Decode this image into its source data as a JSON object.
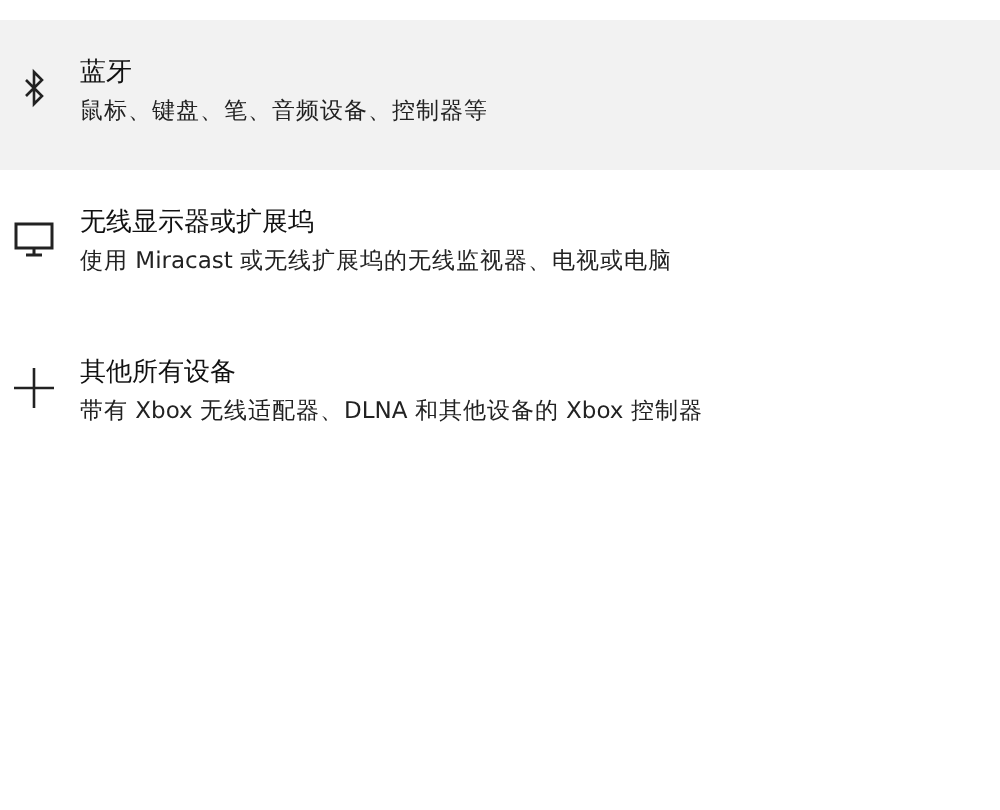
{
  "options": [
    {
      "kind": "bluetooth",
      "title": "蓝牙",
      "subtitle": "鼠标、键盘、笔、音频设备、控制器等",
      "selected": true
    },
    {
      "kind": "display",
      "title": "无线显示器或扩展坞",
      "subtitle": "使用 Miracast 或无线扩展坞的无线监视器、电视或电脑",
      "selected": false
    },
    {
      "kind": "other",
      "title": "其他所有设备",
      "subtitle": "带有 Xbox 无线适配器、DLNA 和其他设备的 Xbox 控制器",
      "selected": false
    }
  ]
}
